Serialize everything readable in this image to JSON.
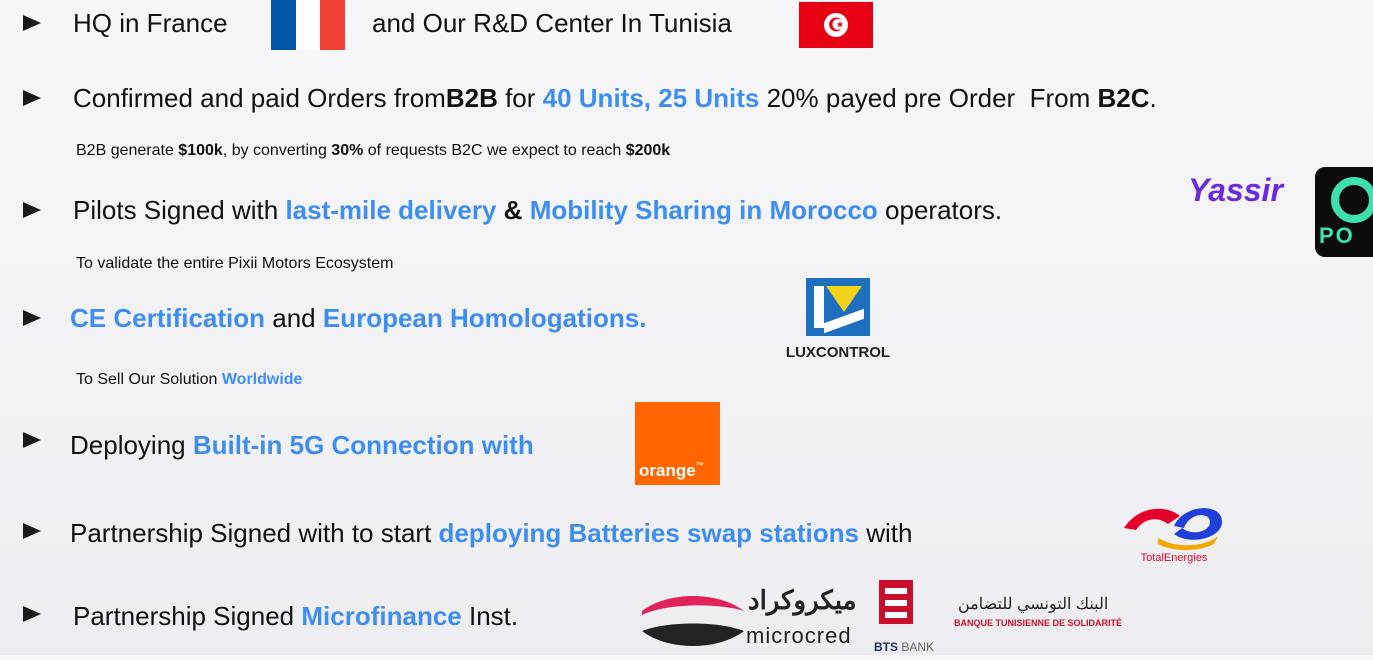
{
  "items": [
    {
      "parts": [
        "HQ in France",
        "and Our R&D Center In Tunisia"
      ]
    },
    {
      "parts": [
        "Confirmed and paid Orders from ",
        "B2B",
        " for ",
        "40 Units, 25 Units",
        " 20% payed pre Order  From ",
        "B2C",
        "."
      ],
      "sub": [
        "B2B generate ",
        "$100k",
        ", by converting ",
        "30%",
        " of requests B2C we expect to reach ",
        "$200k"
      ]
    },
    {
      "parts": [
        "Pilots Signed with ",
        "last-mile delivery",
        " & ",
        "Mobility Sharing in Morocco",
        " operators."
      ],
      "sub": [
        "To validate the entire Pixii Motors Ecosystem"
      ]
    },
    {
      "parts": [
        "CE Certification",
        " and ",
        "European Homologations."
      ],
      "sub": [
        "To Sell Our Solution ",
        "Worldwide"
      ]
    },
    {
      "parts": [
        "Deploying ",
        "Built-in 5G Connection with"
      ]
    },
    {
      "parts": [
        "Partnership Signed with to start ",
        "deploying Batteries swap stations",
        " with"
      ]
    },
    {
      "parts": [
        "Partnership Signed ",
        "Microfinance",
        " Inst."
      ]
    }
  ],
  "logos": {
    "yassir": "Yassir",
    "pos": "PO",
    "luxcontrol": "LUXCONTROL",
    "orange": "orange",
    "orange_tm": "™",
    "totalenergies": "TotalEnergies",
    "microcred_ar": "ميكروكراد",
    "microcred": "microcred",
    "bts_bank_a": "BTS",
    "bts_bank_b": " BANK",
    "bts_ar": "البنك التونسي للتضامن",
    "bts_fr": "BANQUE TUNISIENNE DE SOLIDARITÉ",
    "tn_symbol": "☪"
  },
  "colors": {
    "highlight": "#3d8ef0",
    "orange": "#ff6600",
    "total_red": "#e4002b"
  }
}
